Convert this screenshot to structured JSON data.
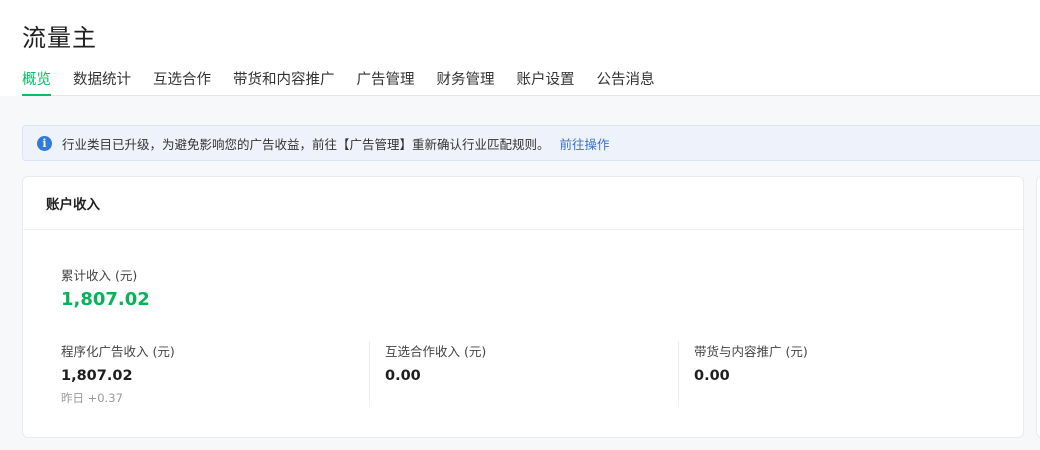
{
  "header": {
    "title": "流量主",
    "tabs": [
      {
        "label": "概览",
        "active": true
      },
      {
        "label": "数据统计"
      },
      {
        "label": "互选合作"
      },
      {
        "label": "带货和内容推广"
      },
      {
        "label": "广告管理"
      },
      {
        "label": "财务管理"
      },
      {
        "label": "账户设置"
      },
      {
        "label": "公告消息"
      }
    ]
  },
  "notice": {
    "icon": "info-icon",
    "text": "行业类目已升级，为避免影响您的广告收益，前往【广告管理】重新确认行业匹配规则。",
    "link": "前往操作"
  },
  "account_income": {
    "title": "账户收入",
    "total_label": "累计收入 (元)",
    "total_value": "1,807.02",
    "metrics": [
      {
        "label": "程序化广告收入 (元)",
        "value": "1,807.02",
        "sub": "昨日 +0.37"
      },
      {
        "label": "互选合作收入 (元)",
        "value": "0.00"
      },
      {
        "label": "带货与内容推广 (元)",
        "value": "0.00"
      }
    ]
  },
  "colors": {
    "accent": "#07c160",
    "income_green": "#07b25a",
    "link": "#3c71c8",
    "info": "#2f7bdc"
  }
}
